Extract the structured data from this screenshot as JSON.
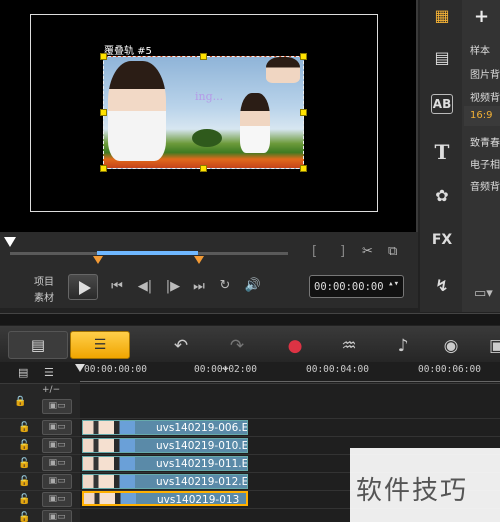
{
  "preview": {
    "overlay_track_label": "覆叠轨 #5",
    "overlay_text": "ing...",
    "timecode": "00:00:00:00"
  },
  "modes": {
    "project": "项目",
    "clip": "素材"
  },
  "right_panel": {
    "items": [
      "样本",
      "图片背",
      "视频背",
      "16:9",
      "致青春",
      "电子相",
      "音频背"
    ],
    "active_index": 3,
    "tools": [
      "media-icon",
      "instant-project-icon",
      "text-icon",
      "title-icon",
      "transition-icon",
      "fx",
      "path-icon"
    ],
    "fx_label": "FX",
    "title_label": "T",
    "ab_label": "AB"
  },
  "timeline": {
    "ruler_ticks": [
      "00:00:00:00",
      "00:00:02:00",
      "00:00:04:00",
      "00:00:06:00"
    ],
    "tracks": [
      {
        "clip": "uvs140219-006.E",
        "selected": false
      },
      {
        "clip": "uvs140219-010.E",
        "selected": false
      },
      {
        "clip": "uvs140219-011.E",
        "selected": false
      },
      {
        "clip": "uvs140219-012.E",
        "selected": false
      },
      {
        "clip": "uvs140219-013",
        "selected": true
      }
    ],
    "track_header_button": "+/−"
  },
  "watermark": "软件技巧",
  "colors": {
    "accent": "#f0a500",
    "clip": "#5a8aa8",
    "selection": "#ffb000",
    "range": "#6fb7ff"
  }
}
